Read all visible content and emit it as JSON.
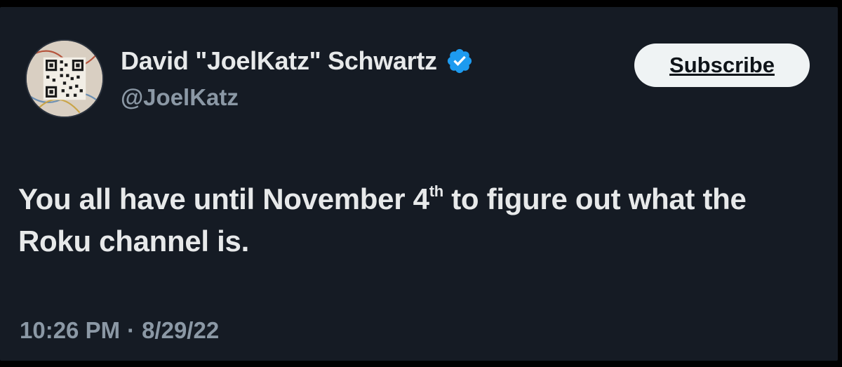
{
  "author": {
    "display_name": "David \"JoelKatz\" Schwartz",
    "handle": "@JoelKatz",
    "avatar_icon": "qr-code-avatar",
    "verified_icon": "verified-badge-icon"
  },
  "subscribe_label": "Subscribe",
  "tweet": {
    "text_before": "You all have until November 4",
    "text_superscript": "th",
    "text_after": " to figure out what the Roku channel is."
  },
  "meta": {
    "time": "10:26 PM",
    "separator": "·",
    "date": "8/29/22"
  },
  "colors": {
    "background": "#151b24",
    "primary_text": "#e7e9ea",
    "secondary_text": "#8b98a5",
    "verified_blue": "#1d9bf0",
    "button_bg": "#eff3f4"
  }
}
